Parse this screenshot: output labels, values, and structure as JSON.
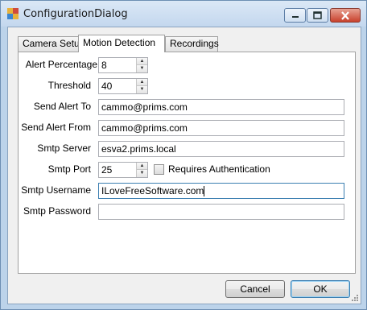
{
  "window": {
    "title": "ConfigurationDialog"
  },
  "tabs": [
    {
      "label": "Camera Setup"
    },
    {
      "label": "Motion Detection"
    },
    {
      "label": "Recordings"
    }
  ],
  "form": {
    "alert_percentage": {
      "label": "Alert Percentage",
      "value": "8"
    },
    "threshold": {
      "label": "Threshold",
      "value": "40"
    },
    "send_alert_to": {
      "label": "Send Alert To",
      "value": "cammo@prims.com"
    },
    "send_alert_from": {
      "label": "Send Alert From",
      "value": "cammo@prims.com"
    },
    "smtp_server": {
      "label": "Smtp Server",
      "value": "esva2.prims.local"
    },
    "smtp_port": {
      "label": "Smtp Port",
      "value": "25"
    },
    "requires_auth": {
      "label": "Requires Authentication",
      "checked": false
    },
    "smtp_username": {
      "label": "Smtp Username",
      "value": "ILoveFreeSoftware.com"
    },
    "smtp_password": {
      "label": "Smtp Password",
      "value": ""
    }
  },
  "buttons": {
    "cancel": "Cancel",
    "ok": "OK"
  }
}
